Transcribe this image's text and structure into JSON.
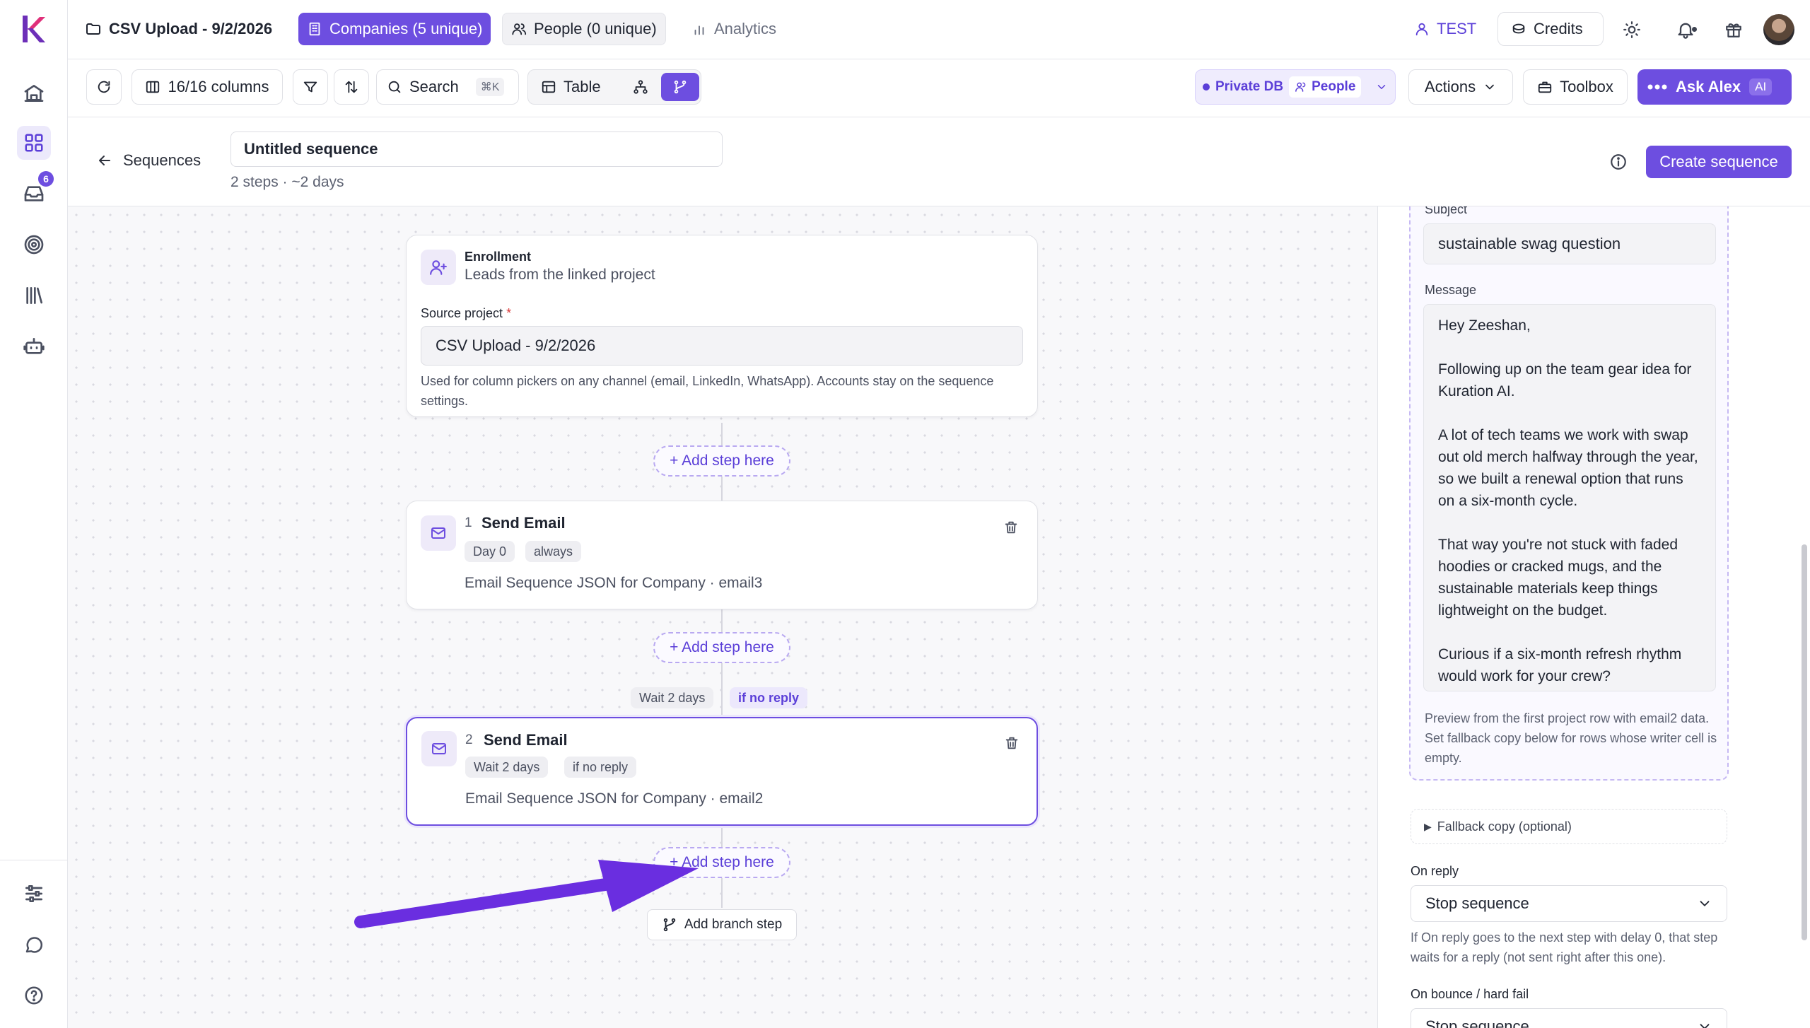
{
  "topbar": {
    "project_title": "CSV Upload - 9/2/2026",
    "tabs": [
      {
        "label": "Companies (5 unique)",
        "active": true
      },
      {
        "label": "People (0 unique)",
        "active": false
      },
      {
        "label": "Analytics",
        "active": false
      }
    ],
    "test_label": "TEST",
    "credits_label": "Credits"
  },
  "rail": {
    "inbox_badge": "6"
  },
  "toolbar": {
    "columns_label": "16/16 columns",
    "search_label": "Search",
    "search_shortcut": "⌘K",
    "view_table_label": "Table",
    "db_label": "Private DB",
    "db_people_label": "People",
    "actions_label": "Actions",
    "toolbox_label": "Toolbox",
    "ask_label": "Ask Alex",
    "ask_badge": "AI"
  },
  "sequence_header": {
    "back_label": "Sequences",
    "name": "Untitled sequence",
    "meta": "2 steps · ~2 days",
    "create_label": "Create sequence"
  },
  "canvas": {
    "enrollment": {
      "title": "Enrollment",
      "subtitle": "Leads from the linked project",
      "source_label": "Source project",
      "required_mark": "*",
      "source_value": "CSV Upload - 9/2/2026",
      "help": "Used for column pickers on any channel (email, LinkedIn, WhatsApp). Accounts stay on the sequence settings."
    },
    "add_step_label": "+ Add step here",
    "steps": [
      {
        "num": "1",
        "title": "Send Email",
        "chips": [
          "Day 0",
          "always"
        ],
        "desc": "Email Sequence JSON for Company · email3"
      },
      {
        "num": "2",
        "title": "Send Email",
        "chips": [
          "Wait 2 days",
          "if no reply"
        ],
        "desc": "Email Sequence JSON for Company · email2"
      }
    ],
    "wait_chip": "Wait 2 days",
    "condition_chip": "if no reply",
    "branch_label": "Add branch step"
  },
  "panel": {
    "subject_label": "Subject",
    "subject_value": "sustainable swag question",
    "message_label": "Message",
    "message_paragraphs": [
      "Hey Zeeshan,",
      "Following up on the team gear idea for Kuration AI.",
      "A lot of tech teams we work with swap out old merch halfway through the year, so we built a renewal option that runs on a six-month cycle.",
      "That way you're not stuck with faded hoodies or cracked mugs, and the sustainable materials keep things lightweight on the budget.",
      "Curious if a six-month refresh rhythm would work for your crew?"
    ],
    "preview_note": "Preview from the first project row with email2 data. Set fallback copy below for rows whose writer cell is empty.",
    "fallback_label": "Fallback copy (optional)",
    "on_reply_label": "On reply",
    "on_reply_value": "Stop sequence",
    "on_reply_help": "If On reply goes to the next step with delay 0, that step waits for a reply (not sent right after this one).",
    "on_bounce_label": "On bounce / hard fail",
    "on_bounce_value": "Stop sequence"
  },
  "colors": {
    "accent": "#6d4ee0",
    "annotation_arrow": "#6a2ee0"
  }
}
